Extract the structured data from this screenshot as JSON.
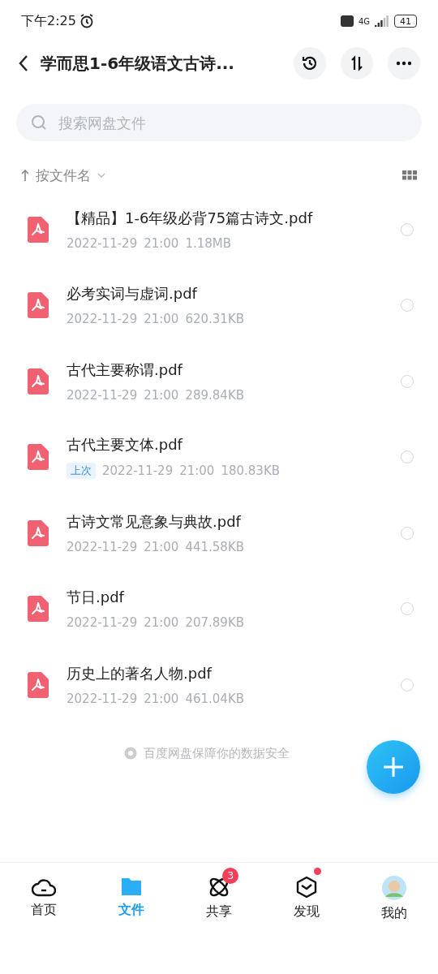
{
  "status_bar": {
    "time": "下午2:25",
    "network": "4G",
    "battery": "41"
  },
  "header": {
    "title": "学而思1-6年级语文古诗..."
  },
  "search": {
    "placeholder": "搜索网盘文件"
  },
  "sort": {
    "label": "按文件名"
  },
  "files": [
    {
      "name": "【精品】1-6年级必背75篇古诗文.pdf",
      "date": "2022-11-29",
      "time": "21:00",
      "size": "1.18MB",
      "selected": false
    },
    {
      "name": "必考实词与虚词.pdf",
      "date": "2022-11-29",
      "time": "21:00",
      "size": "620.31KB",
      "selected": false
    },
    {
      "name": "古代主要称谓.pdf",
      "date": "2022-11-29",
      "time": "21:00",
      "size": "289.84KB",
      "selected": false
    },
    {
      "name": "古代主要文体.pdf",
      "tag": "上次",
      "date": "2022-11-29",
      "time": "21:00",
      "size": "180.83KB",
      "selected": false
    },
    {
      "name": "古诗文常见意象与典故.pdf",
      "date": "2022-11-29",
      "time": "21:00",
      "size": "441.58KB",
      "selected": false
    },
    {
      "name": "节日.pdf",
      "date": "2022-11-29",
      "time": "21:00",
      "size": "207.89KB",
      "selected": false
    },
    {
      "name": "历史上的著名人物.pdf",
      "date": "2022-11-29",
      "time": "21:00",
      "size": "461.04KB",
      "selected": false
    }
  ],
  "footer_note": "百度网盘保障你的数据安全",
  "nav": [
    {
      "kind": "home",
      "label": "首页",
      "selected": false
    },
    {
      "kind": "files",
      "label": "文件",
      "selected": true
    },
    {
      "kind": "share",
      "label": "共享",
      "selected": false,
      "badge": "3"
    },
    {
      "kind": "discover",
      "label": "发现",
      "selected": false,
      "dot": true
    },
    {
      "kind": "me",
      "label": "我的",
      "selected": false
    }
  ]
}
